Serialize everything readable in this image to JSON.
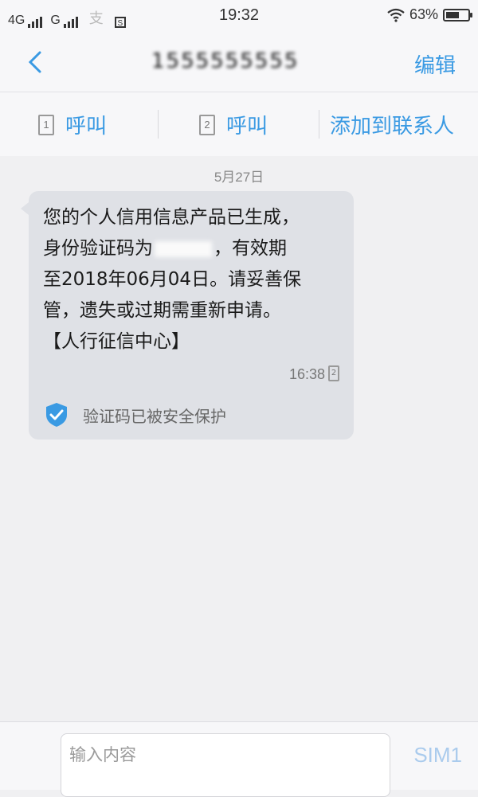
{
  "status_bar": {
    "network1": "4G",
    "network2": "G",
    "time": "19:32",
    "battery": "63%",
    "battery_level": 0.63
  },
  "header": {
    "contact": "1555555555",
    "edit_label": "编辑"
  },
  "actions": {
    "call1_sim": "1",
    "call1_label": "呼叫",
    "call2_sim": "2",
    "call2_label": "呼叫",
    "add_contact_label": "添加到联系人"
  },
  "conversation": {
    "date": "5月27日",
    "message": {
      "line1": "您的个人信用信息产品已生成，",
      "line2_pre": "身份验证码为",
      "line2_post": "，有效期",
      "line3": "至2018年06月04日。请妥善保",
      "line4": "管，遗失或过期需重新申请。",
      "line5": "【人行征信中心】",
      "time": "16:38",
      "sim": "2",
      "secure_note": "验证码已被安全保护"
    }
  },
  "input": {
    "placeholder": "输入内容",
    "send_label": "SIM1"
  },
  "colors": {
    "accent": "#3a9ae3",
    "bubble": "#dfe1e6",
    "background": "#f0f0f2"
  }
}
